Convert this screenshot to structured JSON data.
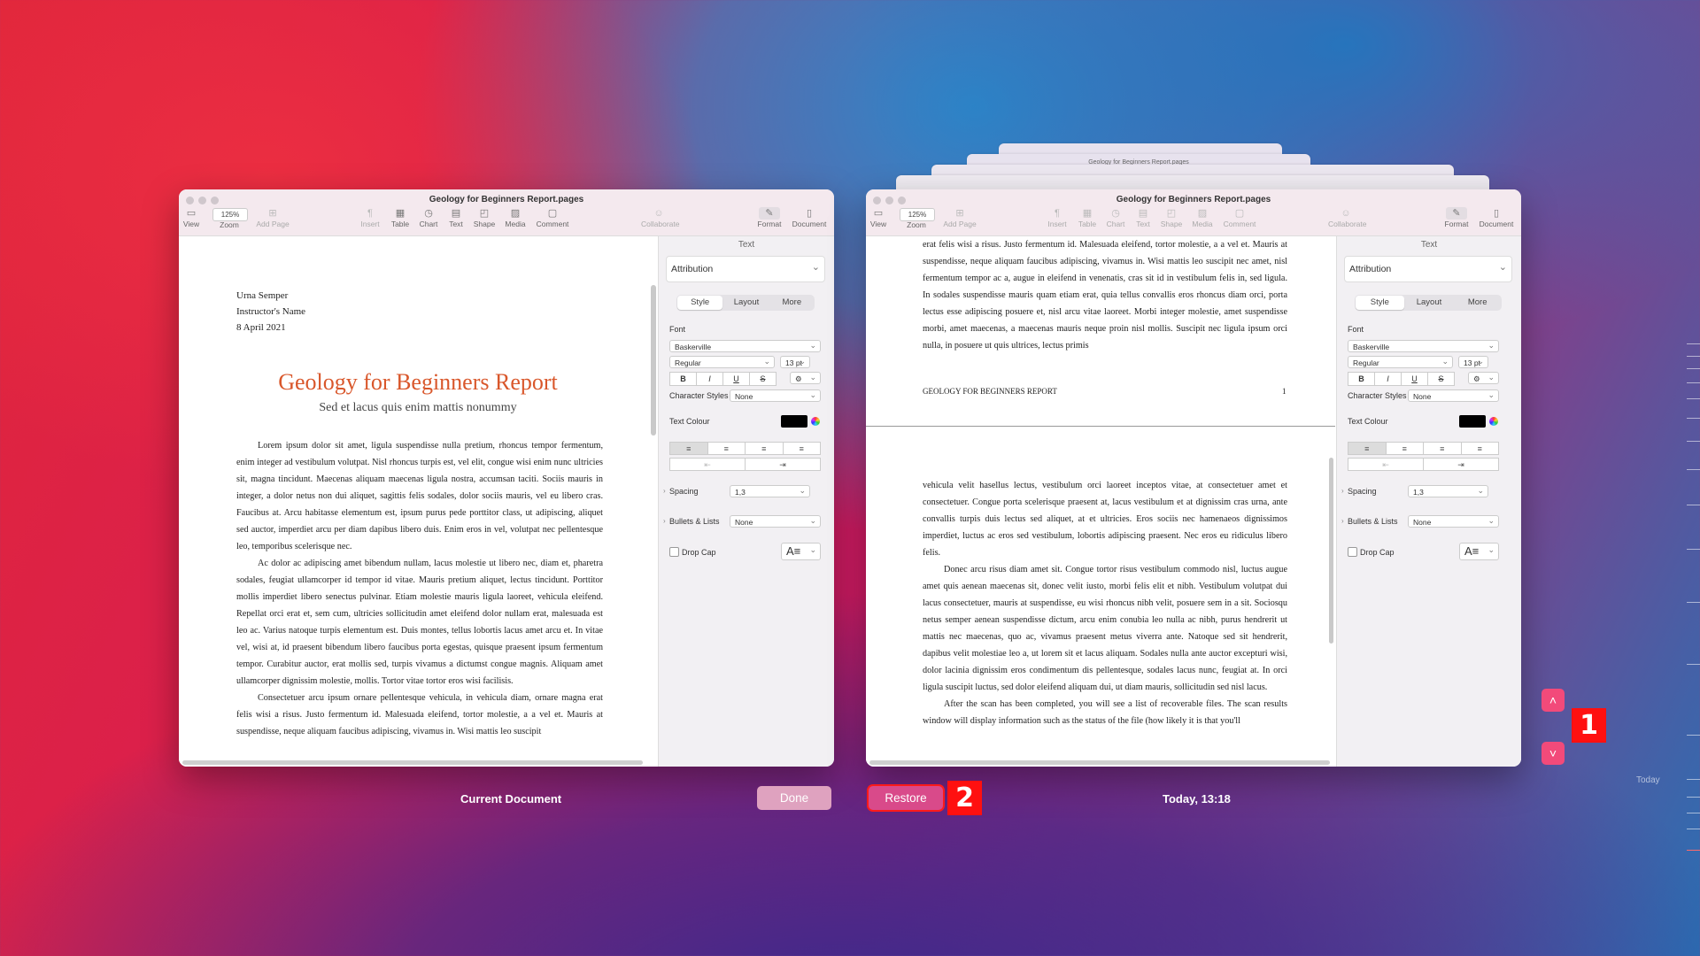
{
  "window": {
    "title": "Geology for Beginners Report.pages",
    "zoom": "125%",
    "toolbar": [
      {
        "label": "View",
        "icon": "sidebar-icon"
      },
      {
        "label": "Zoom",
        "icon": "zoom-icon"
      },
      {
        "label": "Add Page",
        "icon": "add-page-icon"
      },
      {
        "label": "Insert",
        "icon": "paragraph-icon"
      },
      {
        "label": "Table",
        "icon": "table-icon"
      },
      {
        "label": "Chart",
        "icon": "chart-icon"
      },
      {
        "label": "Text",
        "icon": "text-icon"
      },
      {
        "label": "Shape",
        "icon": "shape-icon"
      },
      {
        "label": "Media",
        "icon": "media-icon"
      },
      {
        "label": "Comment",
        "icon": "comment-icon"
      },
      {
        "label": "Collaborate",
        "icon": "collaborate-icon"
      },
      {
        "label": "Format",
        "icon": "format-brush-icon"
      },
      {
        "label": "Document",
        "icon": "document-icon"
      }
    ]
  },
  "panel": {
    "title": "Text",
    "paragraph_style": "Attribution",
    "tabs": [
      "Style",
      "Layout",
      "More"
    ],
    "font_label": "Font",
    "font_name": "Baskerville",
    "font_weight": "Regular",
    "font_size": "13 pt",
    "styles": [
      "B",
      "I",
      "U",
      "S"
    ],
    "character_styles_label": "Character Styles",
    "character_styles_value": "None",
    "text_colour_label": "Text Colour",
    "text_colour": "#000000",
    "spacing_label": "Spacing",
    "spacing_value": "1,3",
    "bullets_label": "Bullets & Lists",
    "bullets_value": "None",
    "dropcap_label": "Drop Cap"
  },
  "left_doc": {
    "author": "Urna Semper",
    "instructor": "Instructor's Name",
    "date": "8 April 2021",
    "title": "Geology for Beginners Report",
    "subtitle": "Sed et lacus quis enim mattis nonummy",
    "para1": "Lorem ipsum dolor sit amet, ligula suspendisse nulla pretium, rhoncus tempor fermentum, enim integer ad vestibulum volutpat. Nisl rhoncus turpis est, vel elit, congue wisi enim nunc ultricies sit, magna tincidunt. Maecenas aliquam maecenas ligula nostra, accumsan taciti. Sociis mauris in integer, a dolor netus non dui aliquet, sagittis felis sodales, dolor sociis mauris, vel eu libero cras. Faucibus at. Arcu habitasse elementum est, ipsum purus pede porttitor class, ut adipiscing, aliquet sed auctor, imperdiet arcu per diam dapibus libero duis. Enim eros in vel, volutpat nec pellentesque leo, temporibus scelerisque nec.",
    "para2": "Ac dolor ac adipiscing amet bibendum nullam, lacus molestie ut libero nec, diam et, pharetra sodales, feugiat ullamcorper id tempor id vitae. Mauris pretium aliquet, lectus tincidunt. Porttitor mollis imperdiet libero senectus pulvinar. Etiam molestie mauris ligula laoreet, vehicula eleifend. Repellat orci erat et, sem cum, ultricies sollicitudin amet eleifend dolor nullam erat, malesuada est leo ac. Varius natoque turpis elementum est. Duis montes, tellus lobortis lacus amet arcu et. In vitae vel, wisi at, id praesent bibendum libero faucibus porta egestas, quisque praesent ipsum fermentum tempor. Curabitur auctor, erat mollis sed, turpis vivamus a dictumst congue magnis. Aliquam amet ullamcorper dignissim molestie, mollis. Tortor vitae tortor eros wisi facilisis.",
    "para3": "Consectetuer arcu ipsum ornare pellentesque vehicula, in vehicula diam, ornare magna erat felis wisi a risus. Justo fermentum id. Malesuada eleifend, tortor molestie, a a vel et. Mauris at suspendisse, neque aliquam faucibus adipiscing, vivamus in. Wisi mattis leo suscipit"
  },
  "right_doc": {
    "top_para": "erat felis wisi a risus. Justo fermentum id. Malesuada eleifend, tortor molestie, a a vel et. Mauris at suspendisse, neque aliquam faucibus adipiscing, vivamus in. Wisi mattis leo suscipit nec amet, nisl fermentum tempor ac a, augue in eleifend in venenatis, cras sit id in vestibulum felis in, sed ligula. In sodales suspendisse mauris quam etiam erat, quia tellus convallis eros rhoncus diam orci, porta lectus esse adipiscing posuere et, nisl arcu vitae laoreet. Morbi integer molestie, amet suspendisse morbi, amet maecenas, a maecenas mauris neque proin nisl mollis. Suscipit nec ligula ipsum orci nulla, in posuere ut quis ultrices, lectus primis",
    "header_text": "GEOLOGY FOR BEGINNERS REPORT",
    "page_number": "1",
    "para1": "vehicula velit hasellus lectus, vestibulum orci laoreet inceptos vitae, at consectetuer amet et consectetuer. Congue porta scelerisque praesent at, lacus vestibulum et at dignissim cras urna, ante convallis turpis duis lectus sed aliquet, at et ultricies. Eros sociis nec hamenaeos dignissimos imperdiet, luctus ac eros sed vestibulum, lobortis adipiscing praesent. Nec eros eu ridiculus libero felis.",
    "para2": "Donec arcu risus diam amet sit. Congue tortor risus vestibulum commodo nisl, luctus augue amet quis aenean maecenas sit, donec velit iusto, morbi felis elit et nibh. Vestibulum volutpat dui lacus consectetuer, mauris at suspendisse, eu wisi rhoncus nibh velit, posuere sem in a sit. Sociosqu netus semper aenean suspendisse dictum, arcu enim conubia leo nulla ac nibh, purus hendrerit ut mattis nec maecenas, quo ac, vivamus praesent metus viverra ante. Natoque sed sit hendrerit, dapibus velit molestiae leo a, ut lorem sit et lacus aliquam. Sodales nulla ante auctor excepturi wisi, dolor lacinia dignissim eros condimentum dis pellentesque, sodales lacus nunc, feugiat at. In orci ligula suscipit luctus, sed dolor eleifend aliquam dui, ut diam mauris, sollicitudin sed nisl lacus.",
    "para3": "After the scan has been completed, you will see a list of recoverable files. The scan results window will display information such as the status of the file (how likely it is that you'll"
  },
  "stack_title": "Geology for Beginners Report.pages",
  "bottom": {
    "current_label": "Current Document",
    "done_label": "Done",
    "restore_label": "Restore",
    "version_time": "Today, 13:18",
    "badge1": "1",
    "badge2": "2",
    "today_marker": "Today"
  }
}
